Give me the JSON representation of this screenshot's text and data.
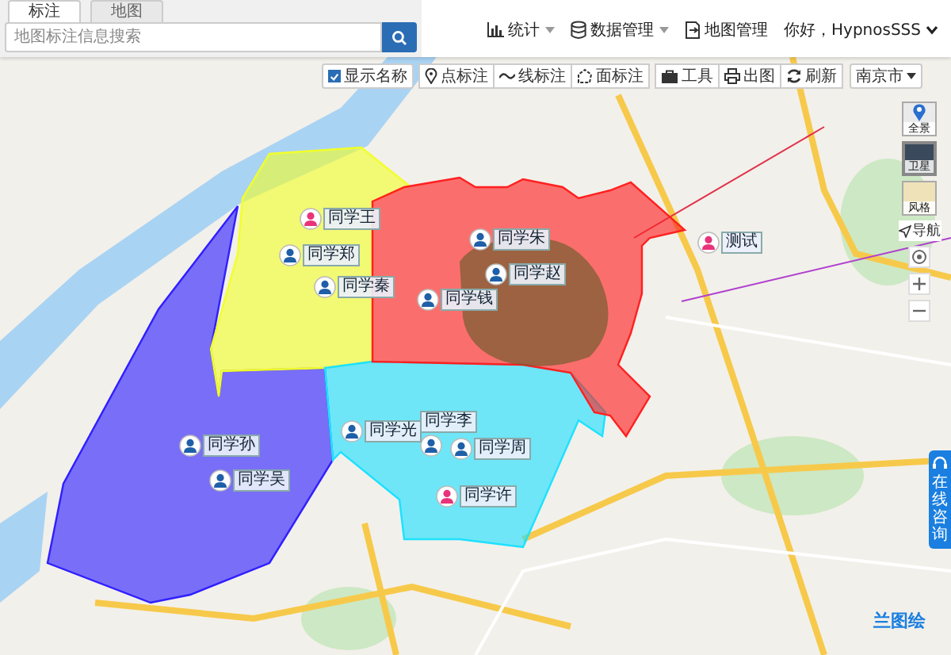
{
  "tabs": [
    {
      "label": "标注",
      "selected": true
    },
    {
      "label": "地图",
      "selected": false
    }
  ],
  "search": {
    "placeholder": "地图标注信息搜索"
  },
  "nav": [
    {
      "label": "统计",
      "kind": "chart",
      "dropdown": true
    },
    {
      "label": "数据管理",
      "kind": "database",
      "dropdown": true
    },
    {
      "label": "地图管理",
      "kind": "export",
      "dropdown": false
    }
  ],
  "user": {
    "greeting": "你好，HypnosSSS"
  },
  "toolbar": {
    "show_names": {
      "label": "显示名称",
      "checked": true
    },
    "groups": [
      [
        {
          "label": "点标注",
          "kind": "pin"
        },
        {
          "label": "线标注",
          "kind": "line"
        },
        {
          "label": "面标注",
          "kind": "polygon"
        }
      ],
      [
        {
          "label": "工具",
          "kind": "toolbox"
        },
        {
          "label": "出图",
          "kind": "print"
        },
        {
          "label": "刷新",
          "kind": "refresh"
        }
      ]
    ],
    "city": "南京市"
  },
  "areas": [
    {
      "color": "#2f1fff"
    },
    {
      "color": "#f2ff2a"
    },
    {
      "color": "#1de1ff"
    },
    {
      "color": "#ff2020"
    }
  ],
  "markers": [
    {
      "label": "同学王",
      "color": "#e8337a"
    },
    {
      "label": "同学朱",
      "color": "#1f5fa8"
    },
    {
      "label": "测试",
      "color": "#e8337a"
    },
    {
      "label": "同学郑",
      "color": "#1f5fa8"
    },
    {
      "label": "同学赵",
      "color": "#1f5fa8"
    },
    {
      "label": "同学秦",
      "color": "#1f5fa8"
    },
    {
      "label": "同学钱",
      "color": "#1f5fa8"
    },
    {
      "label": "同学李",
      "color": "#1f5fa8"
    },
    {
      "label": "同学光",
      "color": "#1f5fa8"
    },
    {
      "label": "同学周",
      "color": "#1f5fa8"
    },
    {
      "label": "同学孙",
      "color": "#1f5fa8"
    },
    {
      "label": "同学吴",
      "color": "#1f5fa8"
    },
    {
      "label": "同学许",
      "color": "#e8337a"
    }
  ],
  "map_types": [
    {
      "label": "全景",
      "kind": "panorama"
    },
    {
      "label": "卫星",
      "kind": "satellite"
    },
    {
      "label": "风格",
      "kind": "style"
    }
  ],
  "navigation": {
    "label": "导航"
  },
  "consult": {
    "label": "在线咨询"
  },
  "logo": {
    "text": "兰图绘"
  }
}
